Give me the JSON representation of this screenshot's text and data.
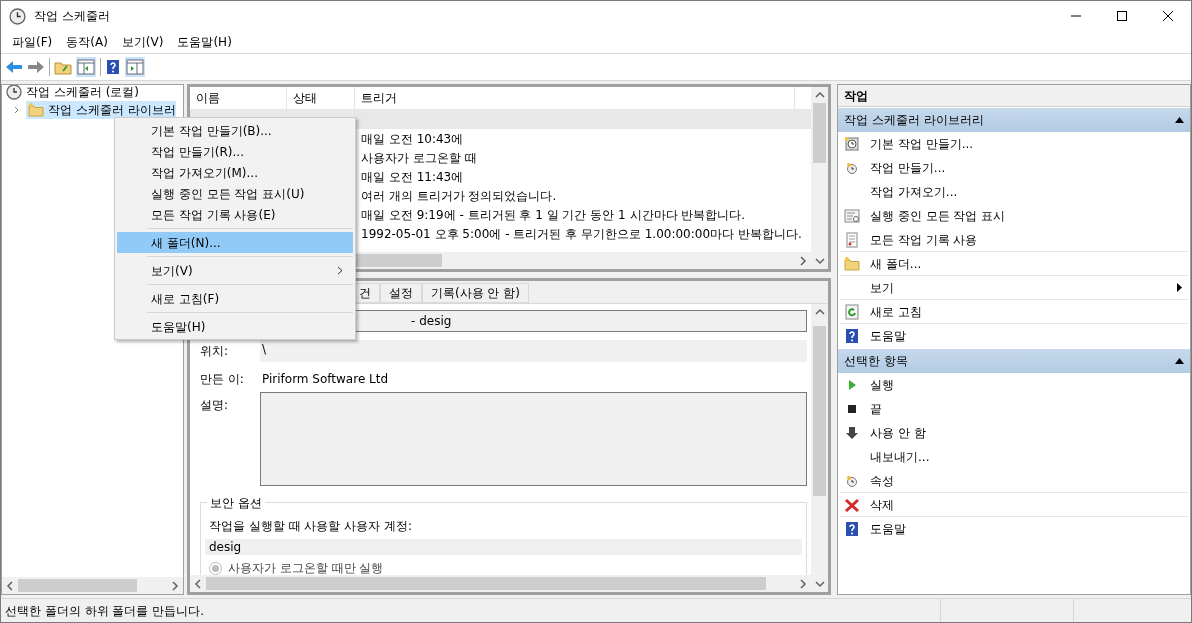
{
  "window": {
    "title": "작업 스케줄러"
  },
  "menu": [
    "파일(F)",
    "동작(A)",
    "보기(V)",
    "도움말(H)"
  ],
  "tree": [
    {
      "label": "작업 스케줄러 (로컬)",
      "selected": false,
      "children": [
        {
          "label": "작업 스케줄러 라이브러",
          "selected": true
        }
      ]
    }
  ],
  "task_list": {
    "columns": [
      "이름",
      "상태",
      "트리거"
    ],
    "rows": [
      {
        "trigger": "",
        "selected": true
      },
      {
        "trigger": "매일 오전 10:43에",
        "selected": false
      },
      {
        "trigger": "사용자가 로그온할 때",
        "selected": false
      },
      {
        "trigger": "매일 오전 11:43에",
        "selected": false
      },
      {
        "trigger": "여러 개의 트리거가 정의되었습니다.",
        "selected": false
      },
      {
        "trigger": "매일 오전 9:19에 - 트리거된 후 1 일 기간 동안 1 시간마다 반복합니다.",
        "selected": false
      },
      {
        "trigger": "1992-05-01 오후 5:00에 - 트리거된 후 무기한으로 1.00:00:00마다 반복합니다.",
        "selected": false
      }
    ]
  },
  "details": {
    "tabs": [
      {
        "label": "건",
        "selected": false
      },
      {
        "label": "설정",
        "selected": false
      },
      {
        "label": "기록(사용 안 함)",
        "selected": false
      }
    ],
    "name_value": "- desig",
    "location_label": "위치:",
    "location_value": "\\",
    "author_label": "만든 이:",
    "author_value": "Piriform Software Ltd",
    "description_label": "설명:",
    "security": {
      "title": "보안 옵션",
      "account_label": "작업을 실행할 때 사용할 사용자 계정:",
      "account": "desig",
      "radio": {
        "label": "사용자가 로그온할 때만 실행",
        "selected": true,
        "disabled": true
      }
    }
  },
  "context_menu": [
    {
      "label": "기본 작업 만들기(B)...",
      "selected": false,
      "divider": false,
      "submenu": false
    },
    {
      "label": "작업 만들기(R)...",
      "selected": false,
      "divider": false,
      "submenu": false
    },
    {
      "label": "작업 가져오기(M)...",
      "selected": false,
      "divider": false,
      "submenu": false
    },
    {
      "label": "실행 중인 모든 작업 표시(U)",
      "selected": false,
      "divider": false,
      "submenu": false
    },
    {
      "label": "모든 작업 기록 사용(E)",
      "selected": false,
      "divider": true,
      "submenu": false
    },
    {
      "label": "새 폴더(N)...",
      "selected": true,
      "divider": true,
      "submenu": false
    },
    {
      "label": "보기(V)",
      "selected": false,
      "divider": true,
      "submenu": true
    },
    {
      "label": "새로 고침(F)",
      "selected": false,
      "divider": true,
      "submenu": false
    },
    {
      "label": "도움말(H)",
      "selected": false,
      "divider": false,
      "submenu": false
    }
  ],
  "actions": {
    "title": "작업",
    "sections": [
      {
        "title": "작업 스케줄러 라이브러리",
        "expanded": true,
        "items": [
          {
            "label": "기본 작업 만들기...",
            "kind": "wizard",
            "divider": false,
            "submenu": false
          },
          {
            "label": "작업 만들기...",
            "kind": "clock",
            "divider": false,
            "submenu": false
          },
          {
            "label": "작업 가져오기...",
            "kind": "plain",
            "divider": false,
            "submenu": false
          },
          {
            "label": "실행 중인 모든 작업 표시",
            "kind": "list",
            "divider": false,
            "submenu": false
          },
          {
            "label": "모든 작업 기록 사용",
            "kind": "log",
            "divider": true,
            "submenu": false
          },
          {
            "label": "새 폴더...",
            "kind": "folder",
            "divider": true,
            "submenu": false
          },
          {
            "label": "보기",
            "kind": "plain",
            "divider": true,
            "submenu": true
          },
          {
            "label": "새로 고침",
            "kind": "refresh",
            "divider": true,
            "submenu": false
          },
          {
            "label": "도움말",
            "kind": "help",
            "divider": false,
            "submenu": false
          }
        ]
      },
      {
        "title": "선택한 항목",
        "expanded": true,
        "items": [
          {
            "label": "실행",
            "kind": "play",
            "divider": false,
            "submenu": false
          },
          {
            "label": "끝",
            "kind": "stop",
            "divider": false,
            "submenu": false
          },
          {
            "label": "사용 안 함",
            "kind": "down",
            "divider": false,
            "submenu": false
          },
          {
            "label": "내보내기...",
            "kind": "plain",
            "divider": false,
            "submenu": false
          },
          {
            "label": "속성",
            "kind": "clock",
            "divider": true,
            "submenu": false
          },
          {
            "label": "삭제",
            "kind": "delete",
            "divider": true,
            "submenu": false
          },
          {
            "label": "도움말",
            "kind": "help",
            "divider": false,
            "submenu": false
          }
        ]
      }
    ]
  },
  "status_bar": "선택한 폴더의 하위 폴더를 만듭니다."
}
